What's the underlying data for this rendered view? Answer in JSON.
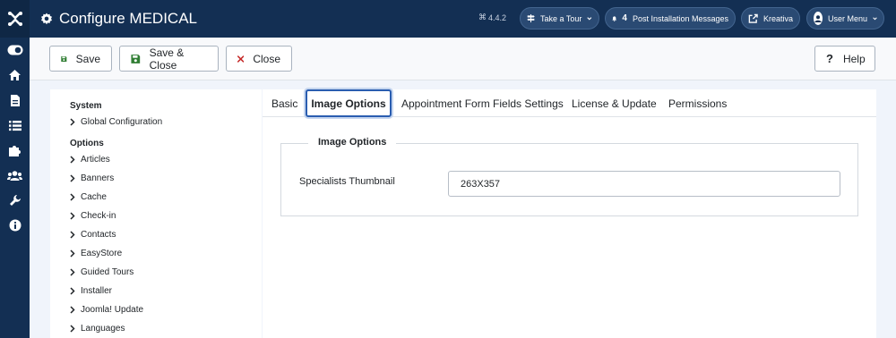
{
  "header": {
    "title": "Configure MEDICAL",
    "version": "4.4.2",
    "take_tour": "Take a Tour",
    "messages_count": "4",
    "messages_label": "Post Installation Messages",
    "site_label": "Kreativa",
    "user_menu": "User Menu"
  },
  "toolbar": {
    "save": "Save",
    "save_close": "Save & Close",
    "close": "Close",
    "help": "Help"
  },
  "sidebar": {
    "system_heading": "System",
    "system_items": [
      "Global Configuration"
    ],
    "options_heading": "Options",
    "options_items": [
      "Articles",
      "Banners",
      "Cache",
      "Check-in",
      "Contacts",
      "EasyStore",
      "Guided Tours",
      "Installer",
      "Joomla! Update",
      "Languages"
    ]
  },
  "tabs": [
    "Basic",
    "Image Options",
    "Appointment Form Fields Settings",
    "License & Update",
    "Permissions"
  ],
  "active_tab": "Image Options",
  "image_options": {
    "legend": "Image Options",
    "thumbnail_label": "Specialists Thumbnail",
    "thumbnail_value": "263X357"
  },
  "colors": {
    "header_bg": "#132f53",
    "accent": "#2a5db0",
    "save_icon": "#2f7d32",
    "close_icon": "#c52827"
  }
}
